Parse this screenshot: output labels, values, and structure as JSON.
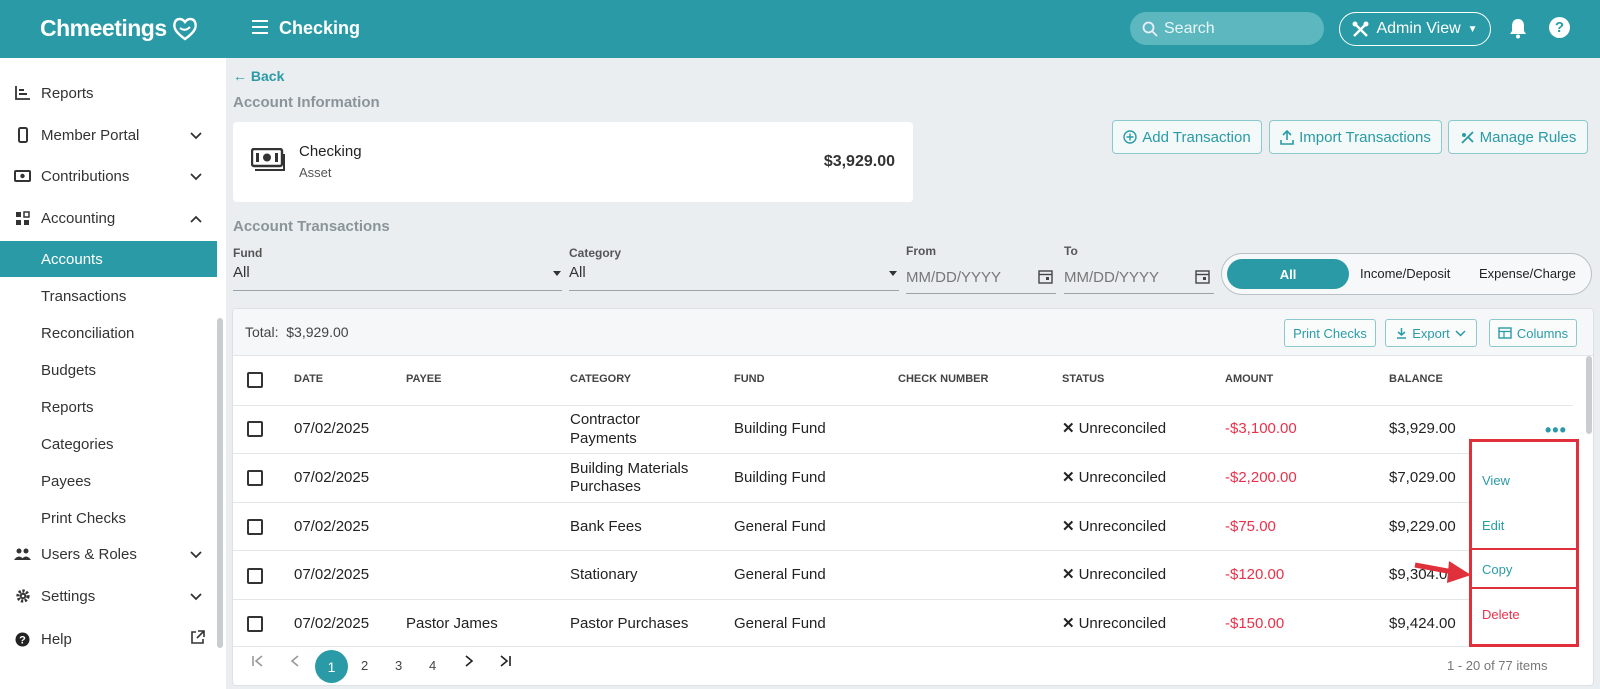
{
  "topbar": {
    "logo_text": "Chmeetings",
    "title": "Checking",
    "search_placeholder": "Search",
    "admin_view_label": "Admin View",
    "help_label": "?"
  },
  "sidebar": {
    "items": [
      {
        "label": "Reports",
        "icon": "bar-chart-icon",
        "chevron": ""
      },
      {
        "label": "Member Portal",
        "icon": "mobile-phone-icon",
        "chevron": "down"
      },
      {
        "label": "Contributions",
        "icon": "money-icon",
        "chevron": "down"
      },
      {
        "label": "Accounting",
        "icon": "grid-icon",
        "chevron": "up"
      },
      {
        "label": "Accounts",
        "active": true
      },
      {
        "label": "Transactions"
      },
      {
        "label": "Reconciliation"
      },
      {
        "label": "Budgets"
      },
      {
        "label": "Reports"
      },
      {
        "label": "Categories"
      },
      {
        "label": "Payees"
      },
      {
        "label": "Print Checks"
      },
      {
        "label": "Users & Roles",
        "icon": "users-icon",
        "chevron": "down"
      },
      {
        "label": "Settings",
        "icon": "gear-icon",
        "chevron": "down"
      },
      {
        "label": "Help",
        "icon": "help-icon",
        "chevron": "external"
      }
    ]
  },
  "main": {
    "back_label": "Back",
    "account_info_title": "Account Information",
    "account": {
      "name": "Checking",
      "type": "Asset",
      "balance": "$3,929.00"
    },
    "actions": {
      "add_transaction": "Add Transaction",
      "import_transactions": "Import Transactions",
      "manage_rules": "Manage Rules"
    },
    "transactions_title": "Account Transactions",
    "filters": {
      "fund_label": "Fund",
      "fund_value": "All",
      "category_label": "Category",
      "category_value": "All",
      "from_label": "From",
      "from_placeholder": "MM/DD/YYYY",
      "to_label": "To",
      "to_placeholder": "MM/DD/YYYY"
    },
    "type_toggle": {
      "all": "All",
      "income": "Income/Deposit",
      "expense": "Expense/Charge"
    },
    "grid": {
      "total_label": "Total:",
      "total_value": "$3,929.00",
      "print_checks": "Print Checks",
      "export": "Export",
      "columns": "Columns",
      "headers": [
        "DATE",
        "PAYEE",
        "CATEGORY",
        "FUND",
        "CHECK NUMBER",
        "STATUS",
        "AMOUNT",
        "BALANCE"
      ],
      "rows": [
        {
          "date": "07/02/2025",
          "payee": "",
          "category": [
            "Contractor",
            "Payments"
          ],
          "fund": "Building Fund",
          "check": "",
          "status": "Unreconciled",
          "amount": "-$3,100.00",
          "balance": "$3,929.00"
        },
        {
          "date": "07/02/2025",
          "payee": "",
          "category": [
            "Building Materials",
            "Purchases"
          ],
          "fund": "Building Fund",
          "check": "",
          "status": "Unreconciled",
          "amount": "-$2,200.00",
          "balance": "$7,029.00"
        },
        {
          "date": "07/02/2025",
          "payee": "",
          "category": [
            "Bank Fees"
          ],
          "fund": "General Fund",
          "check": "",
          "status": "Unreconciled",
          "amount": "-$75.00",
          "balance": "$9,229.00"
        },
        {
          "date": "07/02/2025",
          "payee": "",
          "category": [
            "Stationary"
          ],
          "fund": "General Fund",
          "check": "",
          "status": "Unreconciled",
          "amount": "-$120.00",
          "balance": "$9,304.00"
        },
        {
          "date": "07/02/2025",
          "payee": "Pastor James",
          "category": [
            "Pastor Purchases"
          ],
          "fund": "General Fund",
          "check": "",
          "status": "Unreconciled",
          "amount": "-$150.00",
          "balance": "$9,424.00"
        }
      ],
      "row_menu": {
        "view": "View",
        "edit": "Edit",
        "copy": "Copy",
        "delete": "Delete"
      },
      "pagination": {
        "pages": [
          "1",
          "2",
          "3",
          "4"
        ],
        "current": "1",
        "info": "1 - 20 of 77 items"
      }
    }
  },
  "colors": {
    "accent": "#2a9ba6",
    "negative": "#e8324c",
    "highlight": "#e0303b"
  }
}
